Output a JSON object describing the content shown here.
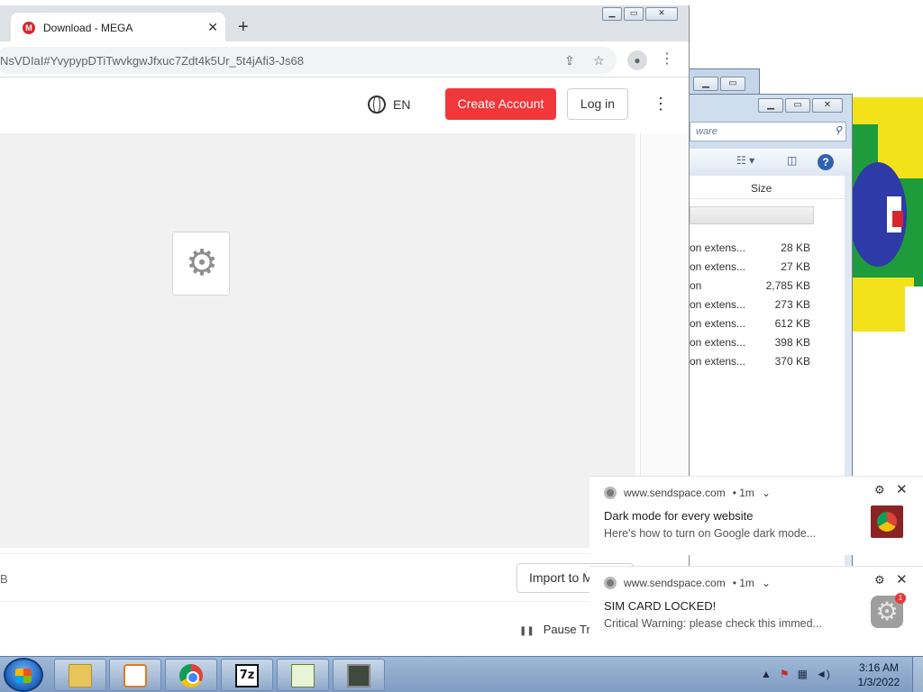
{
  "browser": {
    "tab_title": "Download - MEGA",
    "url": "NsVDIaI#YvypypDTiTwvkgwJfxuc7Zdt4k5Ur_5t4jAfi3-Js68"
  },
  "mega": {
    "language": "EN",
    "create_account": "Create Account",
    "login": "Log in",
    "download_left": "B",
    "import_label": "Import to M",
    "pause_label": "Pause Tra"
  },
  "explorer": {
    "search_placeholder": "ware",
    "col_size": "Size",
    "rows": [
      {
        "type": "on extens...",
        "size": "28 KB"
      },
      {
        "type": "on extens...",
        "size": "27 KB"
      },
      {
        "type": "on",
        "size": "2,785 KB"
      },
      {
        "type": "on extens...",
        "size": "273 KB"
      },
      {
        "type": "on extens...",
        "size": "612 KB"
      },
      {
        "type": "on extens...",
        "size": "398 KB"
      },
      {
        "type": "on extens...",
        "size": "370 KB"
      }
    ]
  },
  "notifications": [
    {
      "source": "www.sendspace.com",
      "age": "• 1m",
      "title": "Dark mode for every website",
      "body": "Here's how to turn on Google dark mode..."
    },
    {
      "source": "www.sendspace.com",
      "age": "• 1m",
      "title": "SIM CARD LOCKED!",
      "body": "Critical Warning: please check this immed..."
    }
  ],
  "taskbar": {
    "time": "3:16 AM",
    "date": "1/3/2022",
    "seven_zip_label": "7z"
  },
  "colors": {
    "mega_red": "#f0373a",
    "chrome_tabstrip": "#dee1e6",
    "taskbar": "#8ea9cc"
  }
}
